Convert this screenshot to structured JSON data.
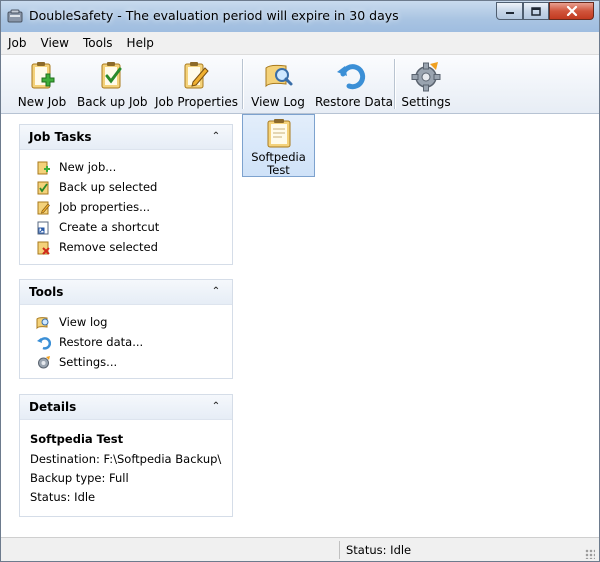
{
  "window": {
    "title": "DoubleSafety - The evaluation period will expire in 30 days",
    "controls": {
      "minimize": "minimize",
      "maximize": "maximize",
      "close": "close"
    }
  },
  "menu": [
    "Job",
    "View",
    "Tools",
    "Help"
  ],
  "toolbar": {
    "new_job": "New Job",
    "back_up_job": "Back up Job",
    "job_properties": "Job Properties",
    "view_log": "View Log",
    "restore_data": "Restore Data",
    "settings": "Settings"
  },
  "panels": {
    "job_tasks": {
      "title": "Job Tasks",
      "items": [
        "New job...",
        "Back up selected",
        "Job properties...",
        "Create a shortcut",
        "Remove selected"
      ]
    },
    "tools": {
      "title": "Tools",
      "items": [
        "View log",
        "Restore data...",
        "Settings..."
      ]
    },
    "details": {
      "title": "Details",
      "name": "Softpedia Test",
      "destination": "Destination: F:\\Softpedia Backup\\",
      "backup_type": "Backup type: Full",
      "status": "Status: Idle"
    }
  },
  "jobs": [
    {
      "label_line1": "Softpedia",
      "label_line2": "Test"
    }
  ],
  "statusbar": {
    "status": "Status: Idle"
  },
  "colors": {
    "accent": "#3399ff",
    "selection": "#cfe2f8",
    "toolbar": "#e7edf5"
  }
}
